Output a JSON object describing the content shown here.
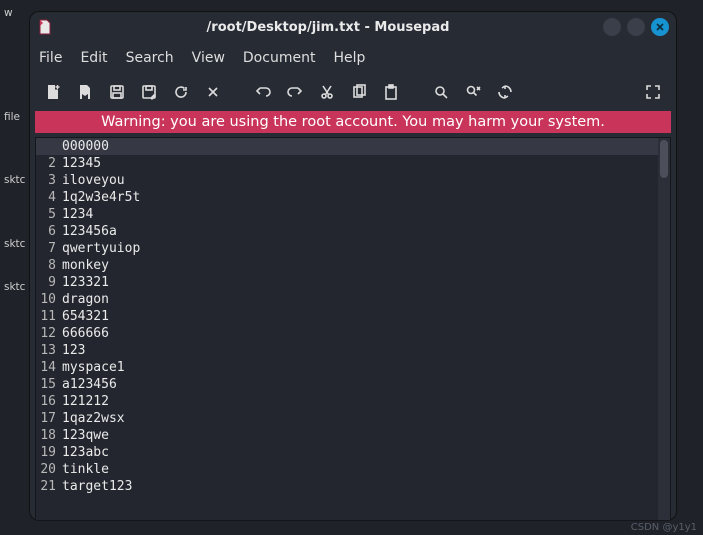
{
  "desktop": {
    "items": [
      "w",
      "file",
      "sktc",
      "sktc",
      "sktc"
    ]
  },
  "window": {
    "title": "/root/Desktop/jim.txt - Mousepad"
  },
  "menu": {
    "file": "File",
    "edit": "Edit",
    "search": "Search",
    "view": "View",
    "document": "Document",
    "help": "Help"
  },
  "toolbar": {
    "new": "new-file",
    "open": "open-file",
    "save": "save-file",
    "save_as": "save-as",
    "reload": "reload",
    "close": "close-file",
    "undo": "undo",
    "redo": "redo",
    "cut": "cut",
    "copy": "copy",
    "paste": "paste",
    "find": "find",
    "find_replace": "find-replace",
    "goto": "goto",
    "fullscreen": "fullscreen"
  },
  "warning": "Warning: you are using the root account. You may harm your system.",
  "editor": {
    "lines": [
      "000000",
      "12345",
      "iloveyou",
      "1q2w3e4r5t",
      "1234",
      "123456a",
      "qwertyuiop",
      "monkey",
      "123321",
      "dragon",
      "654321",
      "666666",
      "123",
      "myspace1",
      "a123456",
      "121212",
      "1qaz2wsx",
      "123qwe",
      "123abc",
      "tinkle",
      "target123"
    ]
  },
  "watermark": "CSDN @y1y1"
}
